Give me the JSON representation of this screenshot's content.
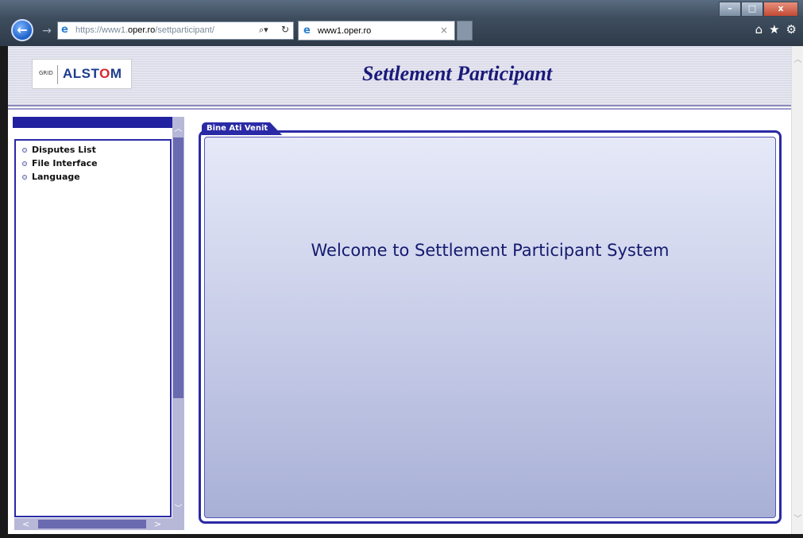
{
  "browser": {
    "url_prefix": "https://www1.",
    "url_domain": "oper.ro",
    "url_path": "/settparticipant/",
    "tab_title": "www1.oper.ro",
    "window_buttons": [
      "–",
      "□",
      "x"
    ],
    "toolbar_icons": [
      "home-icon",
      "favorites-icon",
      "settings-icon"
    ]
  },
  "header": {
    "logo_grid": "GRID",
    "logo_name_pre": "ALST",
    "logo_name_o": "O",
    "logo_name_post": "M",
    "title": "Settlement Participant"
  },
  "sidebar": {
    "items": [
      {
        "label": "Disputes List"
      },
      {
        "label": "File Interface"
      },
      {
        "label": "Language"
      }
    ]
  },
  "main": {
    "tab_label": "Bine Ati Venit",
    "welcome": "Welcome to Settlement Participant System"
  },
  "colors": {
    "accent": "#2a2aa6",
    "title": "#1a1a7a",
    "brand": "#1d3c8c"
  }
}
